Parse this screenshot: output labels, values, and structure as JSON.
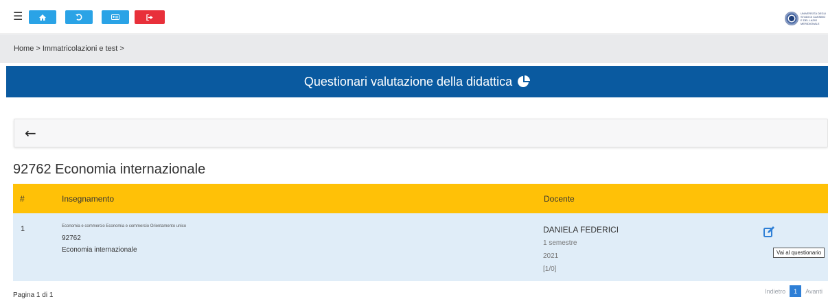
{
  "topbar": {
    "buttons": [
      {
        "name": "home",
        "icon": "home-icon",
        "color": "#2aa3e6"
      },
      {
        "name": "history",
        "icon": "undo-icon",
        "color": "#2aa3e6"
      },
      {
        "name": "card",
        "icon": "id-card-icon",
        "color": "#2aa3e6"
      },
      {
        "name": "logout",
        "icon": "sign-out-icon",
        "color": "#e8303a"
      }
    ],
    "logo_text": "UNIVERSITÀ DEGLI STUDI DI CASSINO E DEL LAZIO MERIDIONALE"
  },
  "breadcrumb": {
    "text": "Home > Immatricolazioni e test >"
  },
  "banner": {
    "title": "Questionari valutazione della didattica",
    "icon": "pie-chart-icon",
    "color": "#0a5aa0"
  },
  "course": {
    "title": "92762 Economia internazionale"
  },
  "table": {
    "headers": {
      "index": "#",
      "course": "Insegnamento",
      "teacher": "Docente"
    },
    "header_color": "#ffc107",
    "row_color": "#e0edf8",
    "rows": [
      {
        "index": "1",
        "program": "Economia e commercio Economia e commercio Orientamento unico",
        "code": "92762",
        "name": "Economia internazionale",
        "teacher": "DANIELA FEDERICI",
        "semester": "1 semestre",
        "year": "2021",
        "progress": "[1/0]",
        "action_tooltip": "Vai al questionario"
      }
    ]
  },
  "pagination": {
    "info": "Pagina 1 di 1",
    "prev": "Indietro",
    "current": "1",
    "next": "Avanti"
  }
}
